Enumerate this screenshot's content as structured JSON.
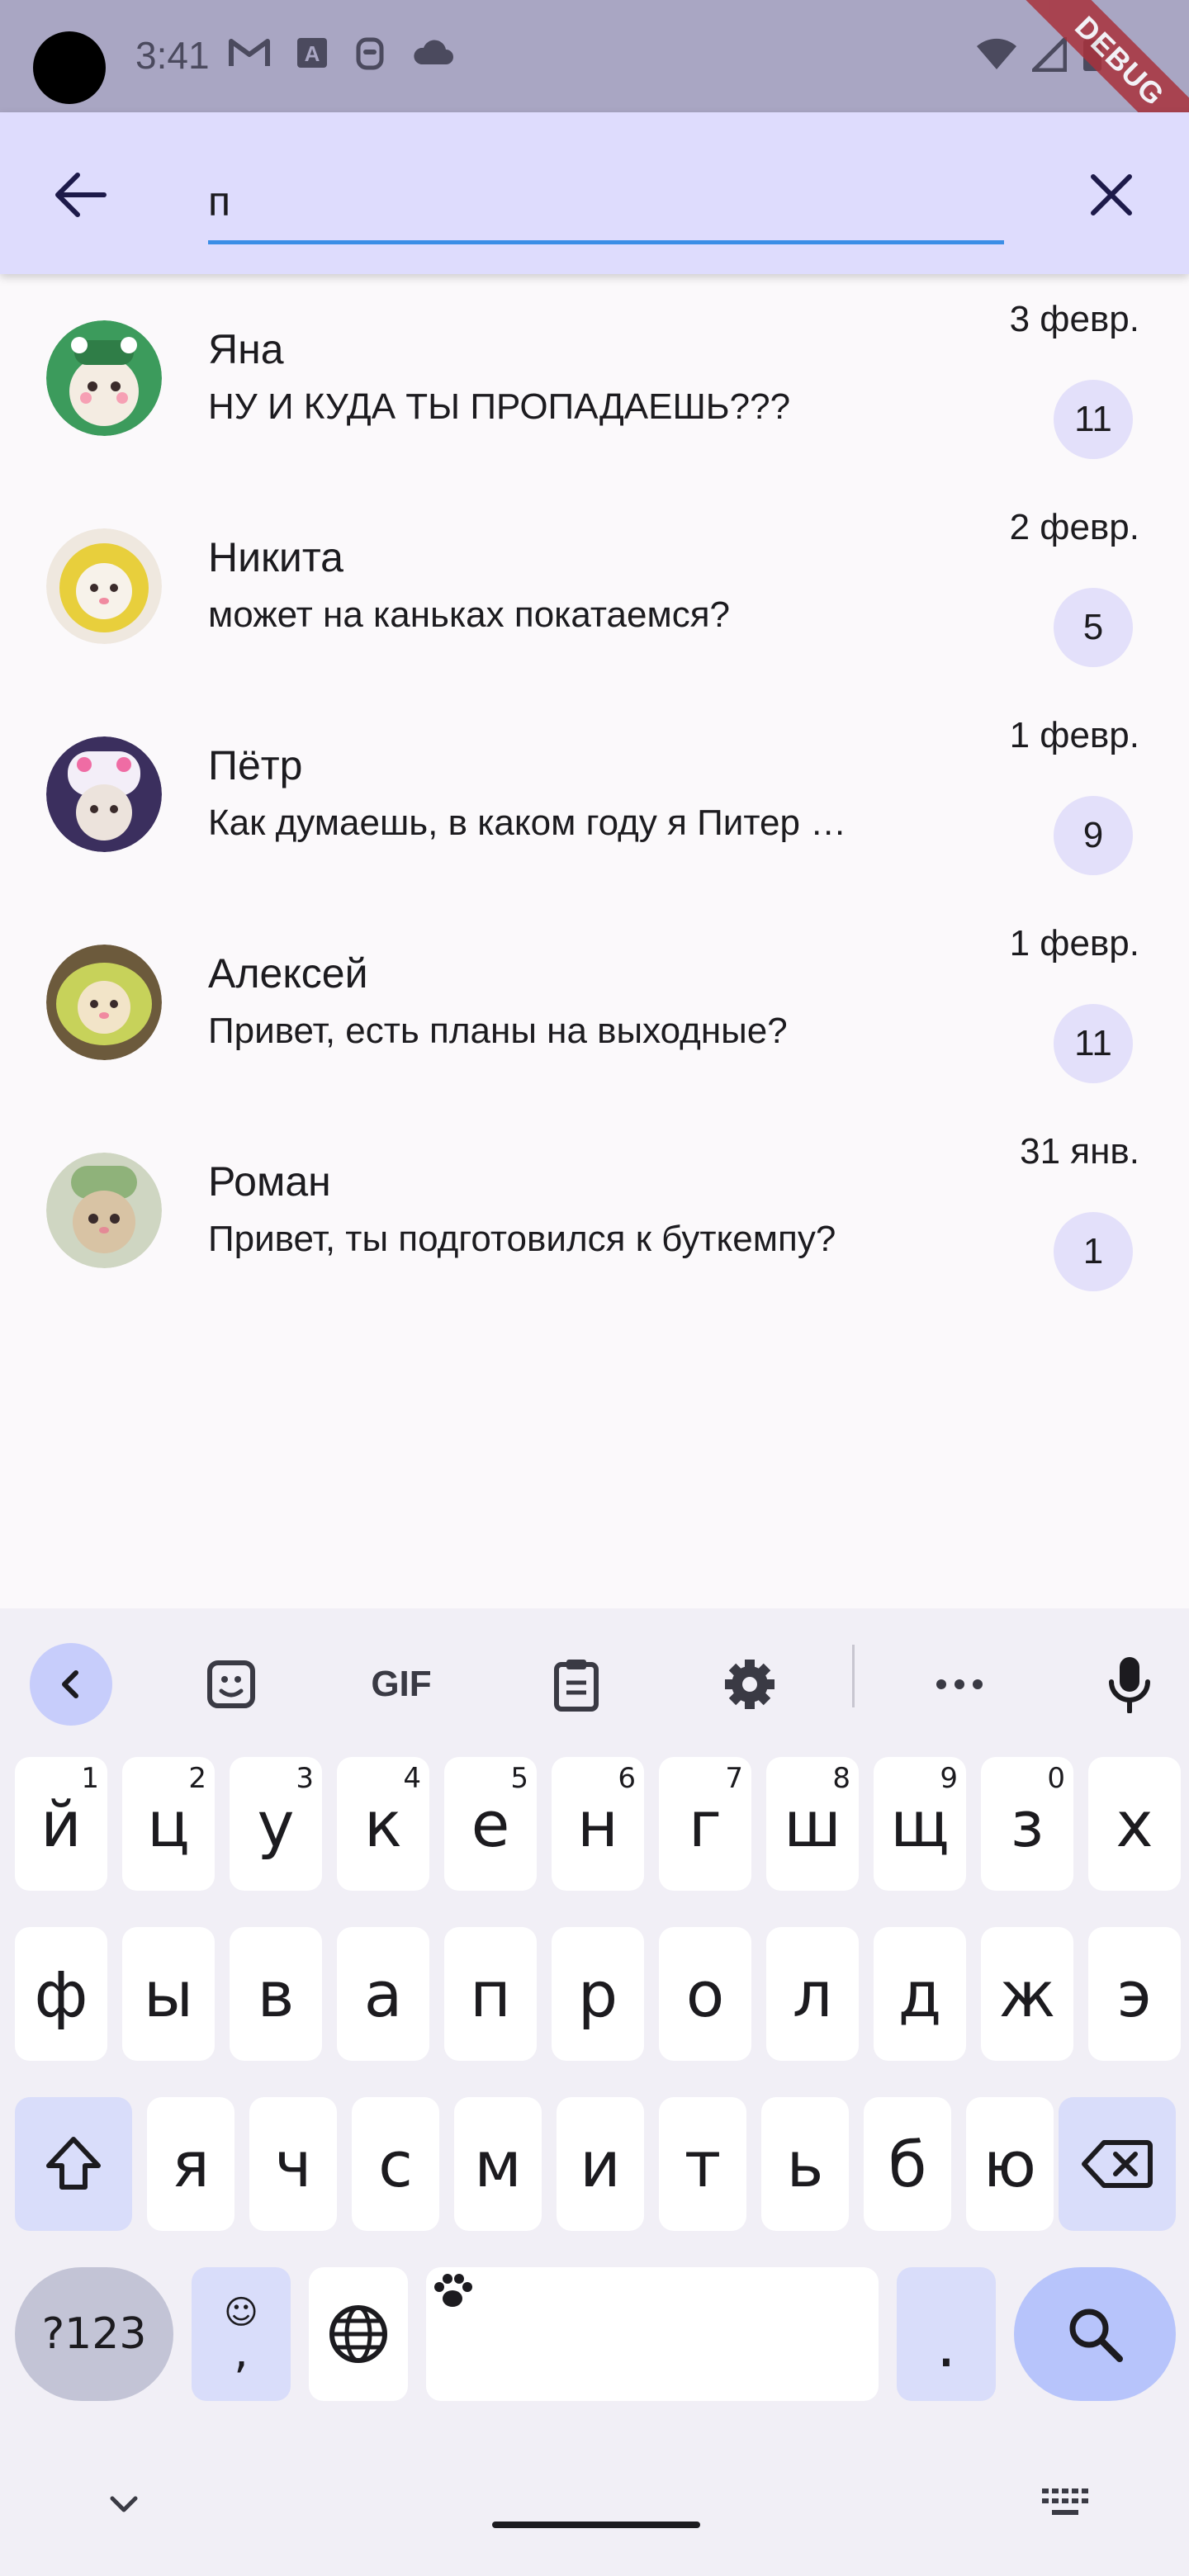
{
  "status_bar": {
    "time": "3:41",
    "icons": [
      "gmail-icon",
      "font-icon",
      "android-icon",
      "cloud-icon"
    ],
    "right_icons": [
      "wifi-icon",
      "signal-icon",
      "battery-icon"
    ],
    "debug_label": "DEBUG"
  },
  "search": {
    "value": "п",
    "back_icon": "arrow-left-icon",
    "clear_icon": "close-icon"
  },
  "chats": [
    {
      "name": "Яна",
      "message": "НУ И КУДА ТЫ ПРОПАДАЕШЬ???",
      "date": "3 февр.",
      "unread": "11",
      "avatar_color": "#3c9b5c"
    },
    {
      "name": "Никита",
      "message": "может на каньках покатаемся?",
      "date": "2 февр.",
      "unread": "5",
      "avatar_color": "#e8cf3c"
    },
    {
      "name": "Пётр",
      "message": "Как думаешь, в каком году я Питер …",
      "date": "1 февр.",
      "unread": "9",
      "avatar_color": "#6a5aa8"
    },
    {
      "name": "Алексей",
      "message": "Привет, есть планы на выходные?",
      "date": "1 февр.",
      "unread": "11",
      "avatar_color": "#c7d25a"
    },
    {
      "name": "Роман",
      "message": "Привет, ты подготовился к буткемпу?",
      "date": "31 янв.",
      "unread": "1",
      "avatar_color": "#8fb27a"
    }
  ],
  "keyboard": {
    "toolbar": [
      "chevron-left-icon",
      "sticker-icon",
      "GIF",
      "clipboard-icon",
      "gear-icon",
      "more-icon",
      "mic-icon"
    ],
    "row1": [
      {
        "k": "й",
        "h": "1"
      },
      {
        "k": "ц",
        "h": "2"
      },
      {
        "k": "у",
        "h": "3"
      },
      {
        "k": "к",
        "h": "4"
      },
      {
        "k": "е",
        "h": "5"
      },
      {
        "k": "н",
        "h": "6"
      },
      {
        "k": "г",
        "h": "7"
      },
      {
        "k": "ш",
        "h": "8"
      },
      {
        "k": "щ",
        "h": "9"
      },
      {
        "k": "з",
        "h": "0"
      },
      {
        "k": "х",
        "h": ""
      }
    ],
    "row2": [
      "ф",
      "ы",
      "в",
      "а",
      "п",
      "р",
      "о",
      "л",
      "д",
      "ж",
      "э"
    ],
    "row3": [
      "я",
      "ч",
      "с",
      "м",
      "и",
      "т",
      "ь",
      "б",
      "ю"
    ],
    "numbers_label": "?123",
    "comma_label": ",",
    "period_label": "."
  }
}
